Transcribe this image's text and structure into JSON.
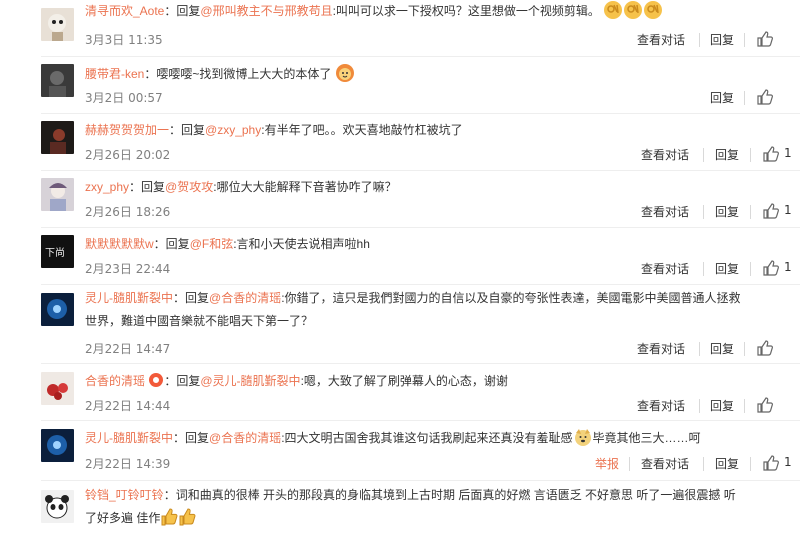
{
  "actions": {
    "view_conversation": "查看对话",
    "reply": "回复",
    "report": "举报"
  },
  "comments": [
    {
      "user": "清寻而欢_Aote",
      "prefix": "：回复",
      "mention": "@邢叫教主不与邢教苟且",
      "content": ":叫叫可以求一下授权吗？这里想做一个视频剪辑。",
      "emoji": "ok-hand-emoji",
      "time": "3月3日 11:35",
      "likes": ""
    },
    {
      "user": "腰带君-ken",
      "prefix": "：",
      "mention": "",
      "content": "嘤嘤嘤~找到微博上大大的本体了",
      "emoji": "lion-face-emoji",
      "time": "3月2日 00:57",
      "likes": ""
    },
    {
      "user": "赫赫贺贺贺加一",
      "prefix": "：回复",
      "mention": "@zxy_phy",
      "content": ":有半年了吧。。欢天喜地敲竹杠被坑了",
      "time": "2月26日 20:02",
      "likes": "1"
    },
    {
      "user": "zxy_phy",
      "prefix": "：回复",
      "mention": "@贺攻攻",
      "content": ":哪位大大能解释下音著协咋了嘛？",
      "time": "2月26日 18:26",
      "likes": "1"
    },
    {
      "user": "默默默默默w",
      "prefix": "：回复",
      "mention": "@F和弦",
      "content": ":言和小天使去说相声啦hh",
      "time": "2月23日 22:44",
      "likes": "1"
    },
    {
      "user": "灵儿-膸肌斳裂中",
      "prefix": "：回复",
      "mention": "@合香的清瑶",
      "content_line1": ":你錯了，這只是我們對國力的自信以及自豪的夸张性表達，美國電影中美國普通人拯救",
      "content_line2": "世界，難道中國音樂就不能唱天下第一了？",
      "time": "2月22日 14:47",
      "likes": ""
    },
    {
      "user": "合香的清瑶",
      "prefix": "：回复",
      "mention": "@灵儿-膸肌斳裂中",
      "content": ":嗯，大致了解了刷弹幕人的心态，谢谢",
      "time": "2月22日 14:44",
      "likes": ""
    },
    {
      "user": "灵儿-膸肌斳裂中",
      "prefix": "：回复",
      "mention": "@合香的清瑶",
      "content": ":四大文明古国舍我其谁这句话我刷起来还真没有羞耻感",
      "content_after": "毕竟其他三大……呵",
      "time": "2月22日 14:39",
      "likes": "1"
    },
    {
      "user": "铃铛_叮铃叮铃",
      "prefix": "：",
      "mention": "",
      "content_line1": "词和曲真的很棒 开头的那段真的身临其境到上古时期 后面真的好燃 言语匮乏 不好意思 听了一遍很震撼 听",
      "content_line2": "了好多遍 佳作"
    }
  ],
  "colors": {
    "accent": "#eb7350",
    "meta": "#808080",
    "text": "#333333"
  }
}
